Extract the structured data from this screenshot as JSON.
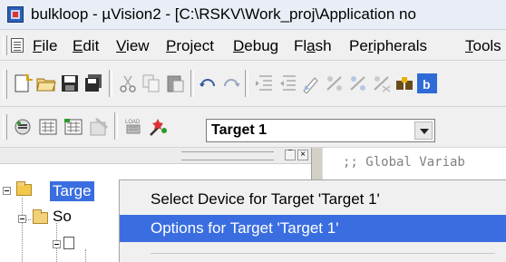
{
  "window": {
    "title": "bulkloop - µVision2 - [C:\\RSKV\\Work_proj\\Application no"
  },
  "menu": [
    {
      "key": "F",
      "rest": "ile"
    },
    {
      "key": "E",
      "rest": "dit"
    },
    {
      "key": "V",
      "rest": "iew"
    },
    {
      "key": "P",
      "rest": "roject"
    },
    {
      "key": "D",
      "rest": "ebug"
    },
    {
      "pre": "Fl",
      "key": "a",
      "rest": "sh"
    },
    {
      "pre": "Pe",
      "key": "r",
      "rest": "ipherals"
    },
    {
      "key": "T",
      "rest": "ools"
    }
  ],
  "toolbar": {
    "target_select": "Target 1"
  },
  "project_tree": {
    "target_label": "Targe",
    "group_label": "So"
  },
  "editor": {
    "first_line": ";; Global Variab"
  },
  "context_menu": {
    "items": [
      "Select Device for Target 'Target 1'",
      "Options for Target 'Target 1'"
    ],
    "highlighted_index": 1
  },
  "colors": {
    "selection": "#3a6ee0",
    "chrome": "#f0f0f0"
  }
}
